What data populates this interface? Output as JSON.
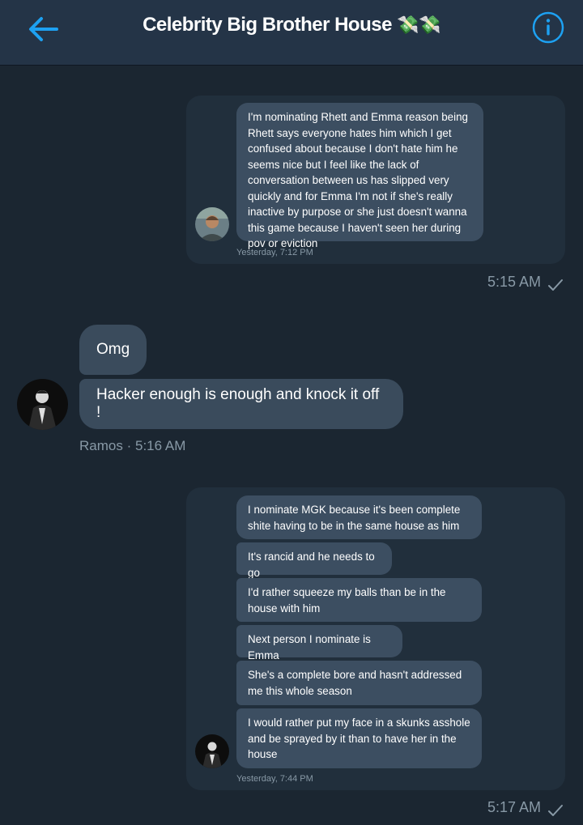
{
  "header": {
    "back_icon": "arrow-left-icon",
    "title": "Celebrity Big Brother House",
    "title_emoji": "💸💸",
    "info_icon": "info-circle-icon",
    "accent_color": "#1da1f2"
  },
  "messages": [
    {
      "type": "sent_screenshot",
      "bubbles": [
        "I'm nominating Rhett and Emma reason being Rhett says everyone hates him which I get confused about because I don't hate him he seems nice but I feel like the lack of conversation between us has slipped very quickly and for Emma I'm not if she's really inactive by purpose or she just doesn't wanna this game because I haven't seen her during pov or eviction"
      ],
      "inner_timestamp": "Yesterday, 7:12 PM",
      "time": "5:15 AM",
      "status_icon": "checkmark-icon"
    },
    {
      "type": "received",
      "bubbles": [
        "Omg",
        "Hacker enough is enough and knock it off !"
      ],
      "sender": "Ramos",
      "separator": "·",
      "time": "5:16 AM"
    },
    {
      "type": "sent_screenshot",
      "bubbles": [
        "I nominate MGK because it's been complete shite having to be in the same house as him",
        "It's rancid and he needs to go",
        "I'd rather squeeze my balls than be in the house with him",
        "Next person I nominate is Emma",
        "She's a complete bore and hasn't addressed me this whole season",
        "I would rather put my face in a skunks asshole and be sprayed by it than to have her in the house"
      ],
      "inner_timestamp": "Yesterday, 7:44 PM",
      "time": "5:17 AM",
      "status_icon": "checkmark-icon"
    }
  ],
  "colors": {
    "background": "#1b2631",
    "header": "#243447",
    "bubble_received": "#3a4b5c",
    "bubble_screenshot": "#3c4e61",
    "muted_text": "#8899a6"
  }
}
